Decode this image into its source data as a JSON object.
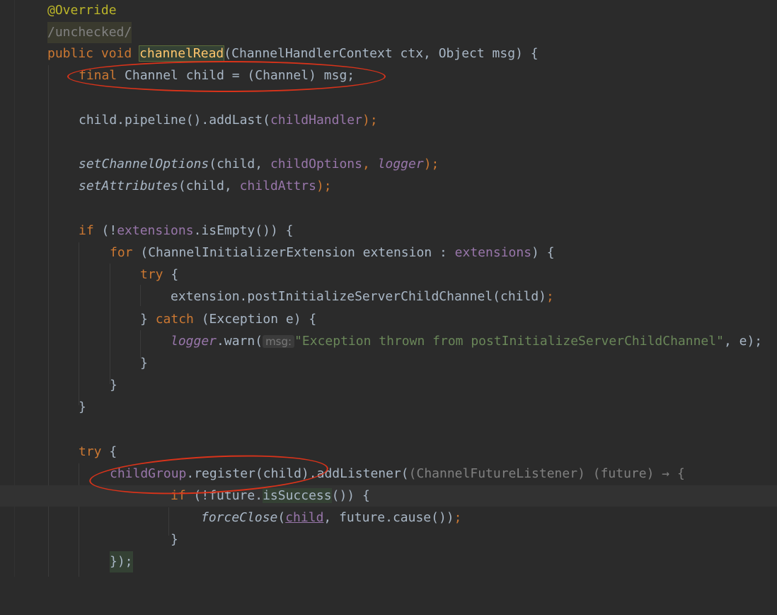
{
  "lines": [
    {
      "id": "override",
      "text": "@Override"
    },
    {
      "id": "unchecked",
      "text": "/unchecked/"
    },
    {
      "id": "sig_public_void",
      "text": "public void "
    },
    {
      "id": "sig_method",
      "text": "channelRead"
    },
    {
      "id": "sig_params",
      "text": "(ChannelHandlerContext ctx, Object msg) {"
    },
    {
      "id": "final_kw",
      "text": "final"
    },
    {
      "id": "final_rest",
      "text": " Channel child = (Channel) msg;"
    },
    {
      "id": "pipeline_a",
      "text": "child.pipeline().addLast("
    },
    {
      "id": "pipeline_field",
      "text": "childHandler"
    },
    {
      "id": "pipeline_end",
      "text": ");"
    },
    {
      "id": "setopt_fn",
      "text": "setChannelOptions"
    },
    {
      "id": "setopt_a",
      "text": "(child, "
    },
    {
      "id": "setopt_f1",
      "text": "childOptions"
    },
    {
      "id": "setopt_f2",
      "text": "logger"
    },
    {
      "id": "setopt_end",
      "text": ");"
    },
    {
      "id": "setattr_fn",
      "text": "setAttributes"
    },
    {
      "id": "setattr_a",
      "text": "(child, "
    },
    {
      "id": "setattr_f1",
      "text": "childAttrs"
    },
    {
      "id": "setattr_end",
      "text": ");"
    },
    {
      "id": "if_kw",
      "text": "if"
    },
    {
      "id": "if_a",
      "text": " (!"
    },
    {
      "id": "if_field",
      "text": "extensions"
    },
    {
      "id": "if_b",
      "text": ".isEmpty()) {"
    },
    {
      "id": "for_kw",
      "text": "for"
    },
    {
      "id": "for_a",
      "text": " (ChannelInitializerExtension extension : "
    },
    {
      "id": "for_field",
      "text": "extensions"
    },
    {
      "id": "for_b",
      "text": ") {"
    },
    {
      "id": "try1_kw",
      "text": "try"
    },
    {
      "id": "try1_b",
      "text": " {"
    },
    {
      "id": "post_a",
      "text": "extension.postInitializeServerChildChannel(child)"
    },
    {
      "id": "post_end",
      "text": ";"
    },
    {
      "id": "catch_a",
      "text": "} "
    },
    {
      "id": "catch_kw",
      "text": "catch"
    },
    {
      "id": "catch_b",
      "text": " (Exception e) {"
    },
    {
      "id": "warn_f",
      "text": "logger"
    },
    {
      "id": "warn_a",
      "text": ".warn("
    },
    {
      "id": "warn_hint",
      "text": "msg:"
    },
    {
      "id": "warn_str",
      "text": "\"Exception thrown from postInitializeServerChildChannel\""
    },
    {
      "id": "warn_end",
      "text": ", e);"
    },
    {
      "id": "brace",
      "text": "}"
    },
    {
      "id": "try2_kw",
      "text": "try"
    },
    {
      "id": "try2_b",
      "text": " {"
    },
    {
      "id": "reg_field",
      "text": "childGroup"
    },
    {
      "id": "reg_a",
      "text": ".register(child).addListener("
    },
    {
      "id": "reg_lambda",
      "text": "(ChannelFutureListener) (future) → {"
    },
    {
      "id": "succ_kw",
      "text": "if"
    },
    {
      "id": "succ_a",
      "text": " (!future."
    },
    {
      "id": "succ_method",
      "text": "isSuccess"
    },
    {
      "id": "succ_b",
      "text": "()) {"
    },
    {
      "id": "force_fn",
      "text": "forceClose"
    },
    {
      "id": "force_a",
      "text": "("
    },
    {
      "id": "force_child",
      "text": "child"
    },
    {
      "id": "force_b",
      "text": ", future.cause())"
    },
    {
      "id": "force_end",
      "text": ";"
    },
    {
      "id": "close_listener",
      "text": "});"
    }
  ],
  "colors": {
    "background": "#2b2b2b",
    "keyword": "#cc7832",
    "annotation": "#bbb529",
    "field": "#9876aa",
    "string": "#6a8759",
    "method_highlight": "#ffc66d",
    "annotation_circle": "#d9331a"
  },
  "icons": [
    "lightbulb-icon"
  ]
}
